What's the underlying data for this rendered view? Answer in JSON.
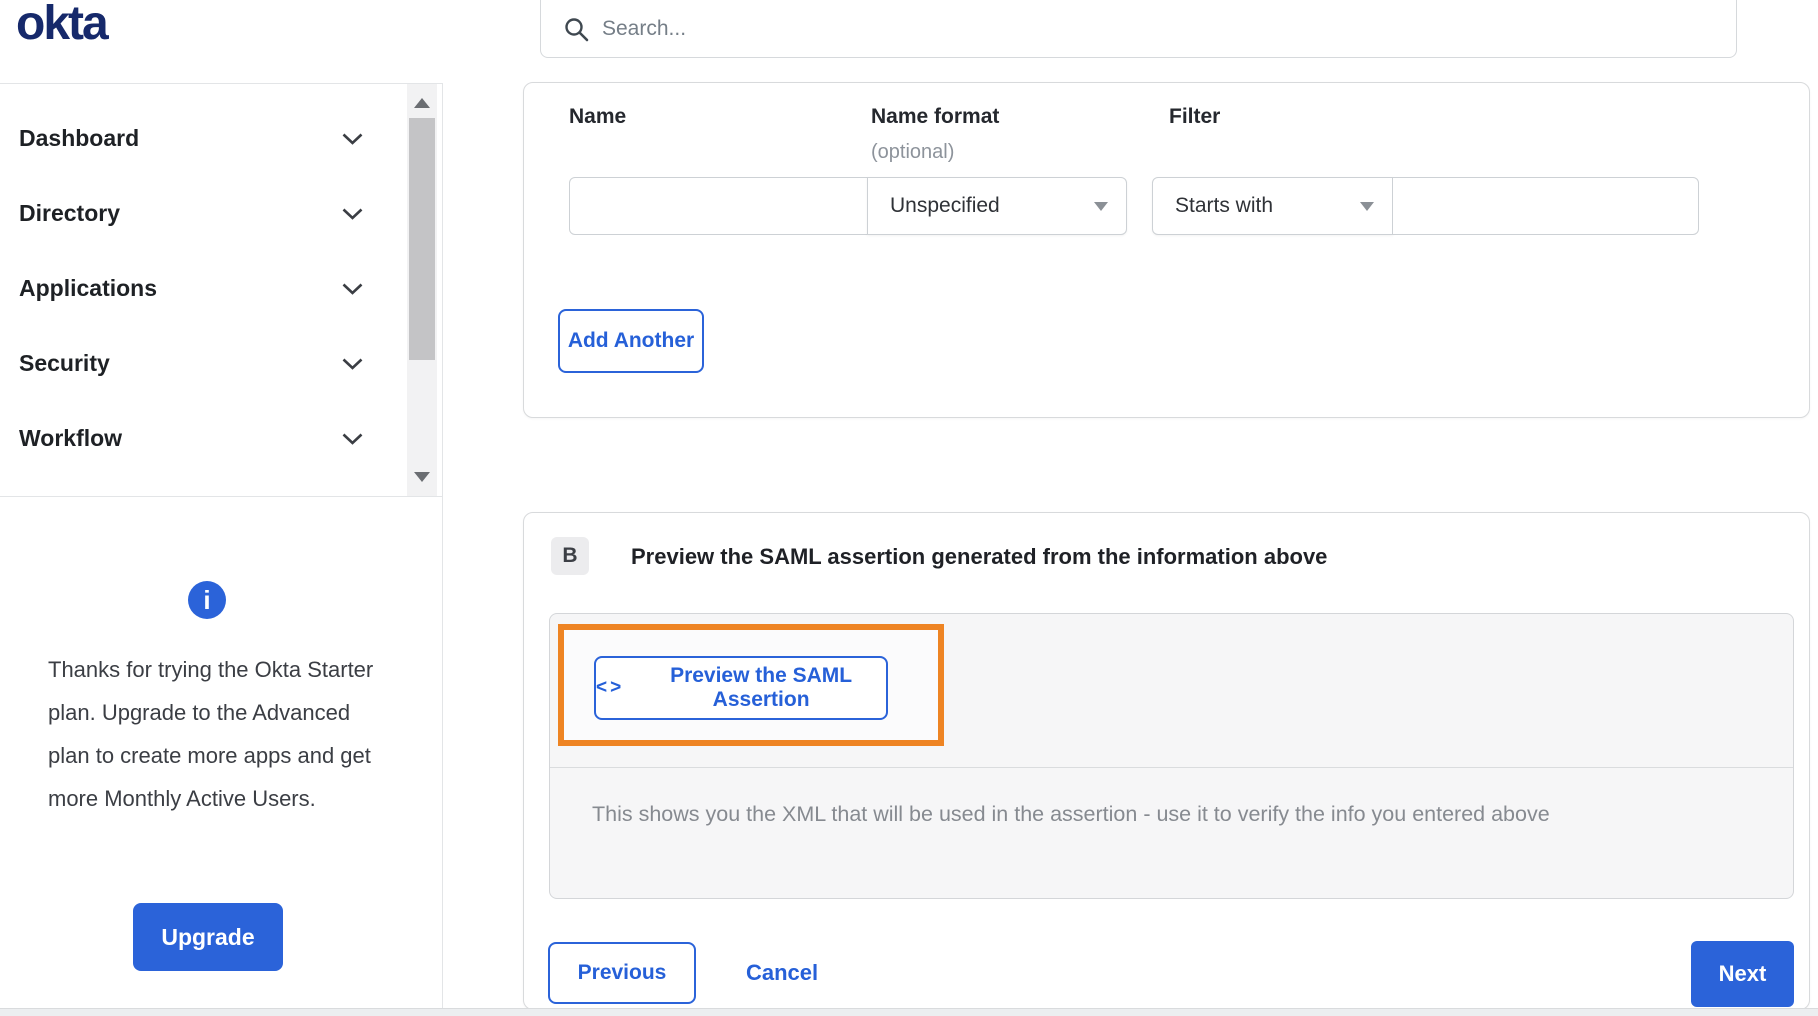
{
  "brand": {
    "logo_text": "okta",
    "logo_color": "#16296b"
  },
  "header": {
    "search": {
      "placeholder": "Search...",
      "icon": "search-icon",
      "value": ""
    }
  },
  "sidebar": {
    "items": [
      {
        "label": "Dashboard",
        "expanded": false
      },
      {
        "label": "Directory",
        "expanded": false
      },
      {
        "label": "Applications",
        "expanded": false
      },
      {
        "label": "Security",
        "expanded": false
      },
      {
        "label": "Workflow",
        "expanded": false
      }
    ],
    "upgrade_notice": {
      "icon": "info-icon",
      "text": "Thanks for trying the Okta Starter plan. Upgrade to the Advanced plan to create more apps and get more Monthly Active Users.",
      "button_label": "Upgrade"
    }
  },
  "attribute_form": {
    "columns": [
      {
        "label": "Name",
        "sublabel": ""
      },
      {
        "label": "Name format",
        "sublabel": "(optional)"
      },
      {
        "label": "Filter",
        "sublabel": ""
      }
    ],
    "row": {
      "name_value": "",
      "name_format_selected": "Unspecified",
      "filter_operator_selected": "Starts with",
      "filter_value": ""
    },
    "add_button_label": "Add Another"
  },
  "preview_section": {
    "step_label": "B",
    "title": "Preview the SAML assertion generated from the information above",
    "preview_button_icon": "<>",
    "preview_button_label": "Preview the SAML Assertion",
    "description": "This shows you the XML that will be used in the assertion - use it to verify the info you entered above",
    "highlight_color": "#ee8423"
  },
  "wizard_footer": {
    "previous_label": "Previous",
    "cancel_label": "Cancel",
    "next_label": "Next"
  },
  "colors": {
    "accent_blue": "#2b63d9",
    "link_blue": "#2660d8",
    "highlight_orange": "#ee8423",
    "logo_navy": "#16296b",
    "panel_gray": "#f6f6f7"
  }
}
